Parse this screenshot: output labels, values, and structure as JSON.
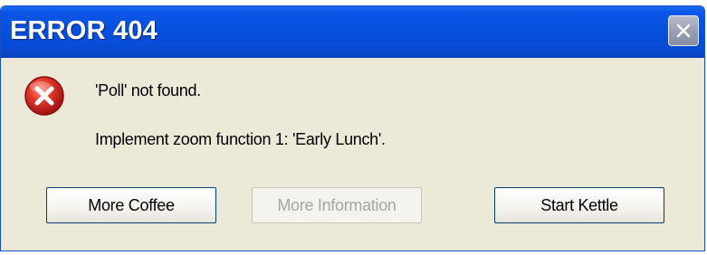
{
  "window": {
    "title": "ERROR 404"
  },
  "icons": {
    "error": "error-circle-x-icon",
    "close": "close-x-icon"
  },
  "messages": {
    "line1": "'Poll' not found.",
    "line2": "Implement zoom function 1: 'Early Lunch'."
  },
  "buttons": {
    "coffee": "More Coffee",
    "info": "More Information",
    "kettle": "Start Kettle"
  },
  "colors": {
    "titlebar": "#0650dc",
    "dialog_bg": "#ece9d8",
    "error_red": "#d42020",
    "disabled_text": "#a7a6a0"
  }
}
